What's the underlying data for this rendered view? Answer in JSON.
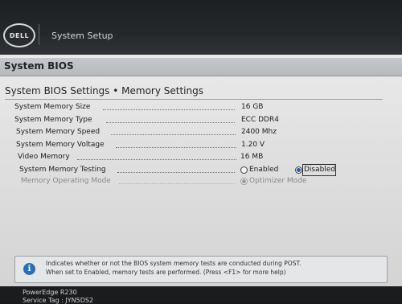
{
  "header": {
    "logo_text": "DELL",
    "title": "System Setup"
  },
  "bios": {
    "title": "System BIOS",
    "section_title": "System BIOS Settings • Memory Settings"
  },
  "settings": [
    {
      "label": "System Memory Size",
      "value": "16 GB"
    },
    {
      "label": "System Memory Type",
      "value": "ECC DDR4"
    },
    {
      "label": "System Memory Speed",
      "value": "2400 Mhz"
    },
    {
      "label": "System Memory Voltage",
      "value": "1.20 V"
    },
    {
      "label": "Video Memory",
      "value": "16 MB"
    },
    {
      "label": "System Memory Testing",
      "options": [
        "Enabled",
        "Disabled"
      ],
      "selected": "Disabled"
    },
    {
      "label": "Memory Operating Mode",
      "value": "Optimizer Mode",
      "disabled": true
    }
  ],
  "help": {
    "line1": "Indicates whether or not the BIOS system memory tests are conducted during POST.",
    "line2": "When set to Enabled, memory tests are performed. (Press <F1> for more help)"
  },
  "footer": {
    "model": "PowerEdge R230",
    "service_tag": "Service Tag : JYN5DS2"
  }
}
